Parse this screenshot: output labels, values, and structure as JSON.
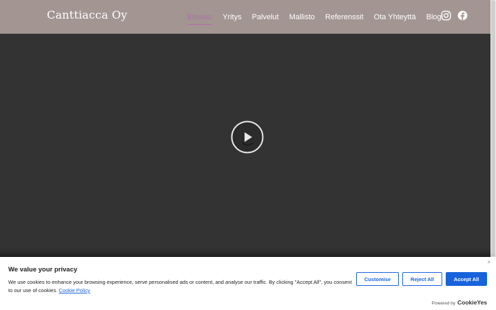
{
  "header": {
    "brand": "Canttiacca Oy",
    "nav": [
      {
        "label": "Etusivu",
        "active": true
      },
      {
        "label": "Yritys",
        "active": false
      },
      {
        "label": "Palvelut",
        "active": false
      },
      {
        "label": "Mallisto",
        "active": false
      },
      {
        "label": "Referenssit",
        "active": false
      },
      {
        "label": "Ota Yhteyttä",
        "active": false
      },
      {
        "label": "Blogi",
        "active": false
      }
    ],
    "social": [
      {
        "icon": "instagram-icon"
      },
      {
        "icon": "facebook-icon"
      }
    ]
  },
  "video": {
    "play_icon": "play-icon"
  },
  "cookie_banner": {
    "title": "We value your privacy",
    "text": "We use cookies to enhance your browsing experience, serve personalised ads or content, and analyse our traffic. By clicking \"Accept All\", you consent to our use of cookies.",
    "policy_link": "Cookie Policy",
    "close": "×",
    "buttons": {
      "customise": "Customise",
      "reject": "Reject All",
      "accept": "Accept All"
    },
    "powered_by": "Powered by",
    "powered_brand": "CookieYes"
  },
  "colors": {
    "header_bg": "#a29592",
    "active_nav": "#b26bb0",
    "video_bg": "#333333",
    "accent": "#1863dc"
  }
}
